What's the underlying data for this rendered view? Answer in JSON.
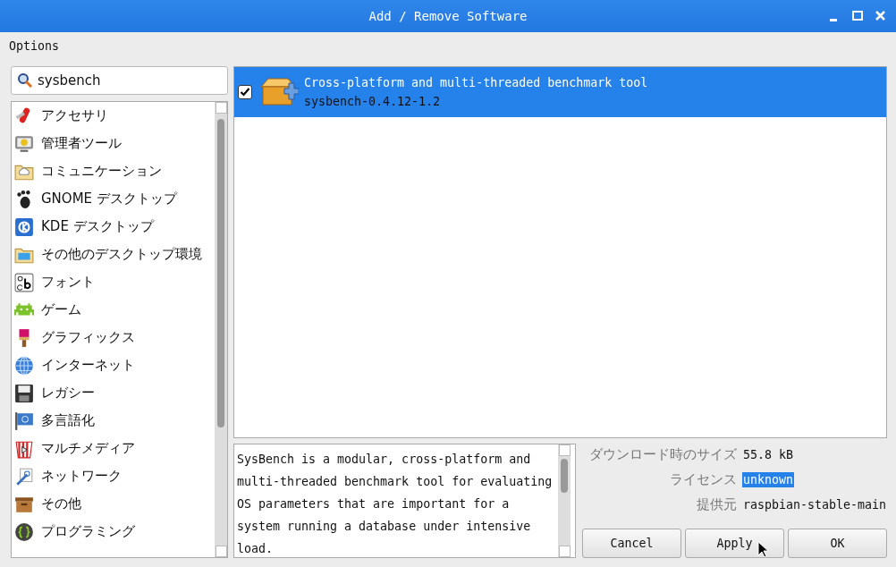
{
  "window": {
    "title": "Add / Remove Software"
  },
  "menu": [
    "Options"
  ],
  "search": {
    "value": "sysbench"
  },
  "categories": [
    {
      "label": "アクセサリ"
    },
    {
      "label": "管理者ツール"
    },
    {
      "label": "コミュニケーション"
    },
    {
      "label": "GNOME デスクトップ"
    },
    {
      "label": "KDE デスクトップ"
    },
    {
      "label": "その他のデスクトップ環境"
    },
    {
      "label": "フォント"
    },
    {
      "label": "ゲーム"
    },
    {
      "label": "グラフィックス"
    },
    {
      "label": "インターネット"
    },
    {
      "label": "レガシー"
    },
    {
      "label": "多言語化"
    },
    {
      "label": "マルチメディア"
    },
    {
      "label": "ネットワーク"
    },
    {
      "label": "その他"
    },
    {
      "label": "プログラミング"
    }
  ],
  "packages": [
    {
      "summary": "Cross-platform and multi-threaded benchmark tool",
      "name": "sysbench-0.4.12-1.2",
      "checked": true,
      "selected": true
    }
  ],
  "description": "SysBench is a modular, cross-platform and multi-threaded benchmark tool for evaluating OS parameters that are important for a system running a database under intensive load.",
  "details": [
    {
      "label": "ダウンロード時のサイズ",
      "value": "55.8 kB",
      "highlighted": false
    },
    {
      "label": "ライセンス",
      "value": "unknown",
      "highlighted": true
    },
    {
      "label": "提供元",
      "value": "raspbian-stable-main",
      "highlighted": false
    }
  ],
  "buttons": [
    "Cancel",
    "Apply",
    "OK"
  ]
}
